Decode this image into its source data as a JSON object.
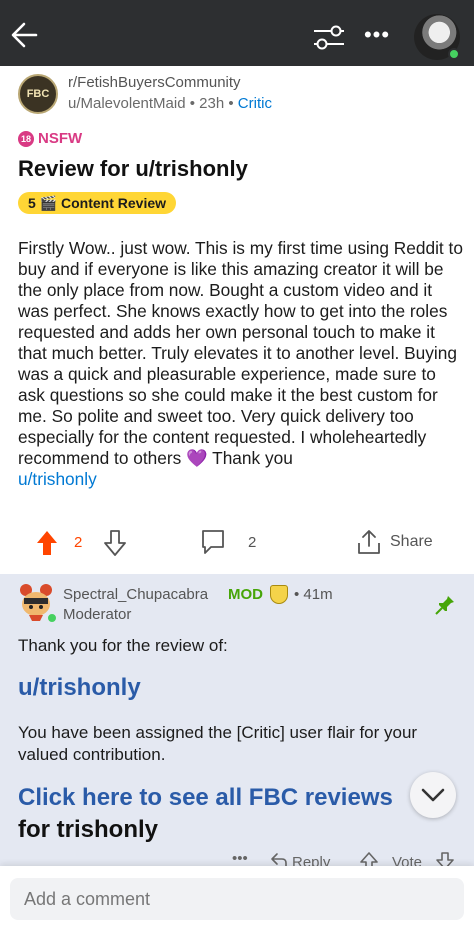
{
  "topbar": {
    "back_icon": "arrow-left-icon",
    "filter_icon": "sliders-icon",
    "more_label": "•••",
    "avatar": "user-avatar"
  },
  "post": {
    "subreddit": "r/FetishBuyersCommunity",
    "subreddit_icon_text": "FBC",
    "author": "u/MalevolentMaid",
    "time": "23h",
    "user_flair": "Critic",
    "nsfw_badge": "18",
    "nsfw_label": "NSFW",
    "title": "Review for u/trishonly",
    "flair": "5 🎬 Content Review",
    "body_text": "Firstly Wow.. just wow. This is my first time using Reddit to buy and if everyone is like this amazing creator it will be the only place from now. Bought a custom video and it was perfect. She knows exactly how to get into the roles requested and adds her own personal touch to make it that much better. Truly elevates it to another level. Buying was a quick and pleasurable experience, made sure to ask questions so she could make it the best custom for me. So polite and sweet too. Very quick delivery too especially for the content requested. I wholeheartedly recommend to others",
    "body_heart": "💜",
    "body_tail": "Thank you",
    "body_link": "u/trishonly",
    "vote_count": "2",
    "comment_count": "2",
    "share_label": "Share",
    "colors": {
      "upvote": "#ff4500",
      "link": "#0079d3",
      "flair_bg": "#ffd635",
      "nsfw": "#d93a84"
    }
  },
  "comment": {
    "username": "Spectral_Chupacabra",
    "mod_badge": "MOD",
    "time": "41m",
    "role": "Moderator",
    "line1": "Thank you for the review of:",
    "user_link": "u/trishonly",
    "line2": "You have been assigned the [Critic] user flair for your valued contribution.",
    "link_text": "Click here to see all FBC reviews",
    "for_text": "for trishonly",
    "more_label": "•••",
    "reply_label": "Reply",
    "vote_label": "Vote",
    "colors": {
      "background": "#e4e8f2",
      "mod": "#46a508",
      "link": "#2a5ba8"
    }
  },
  "composer": {
    "placeholder": "Add a comment"
  }
}
